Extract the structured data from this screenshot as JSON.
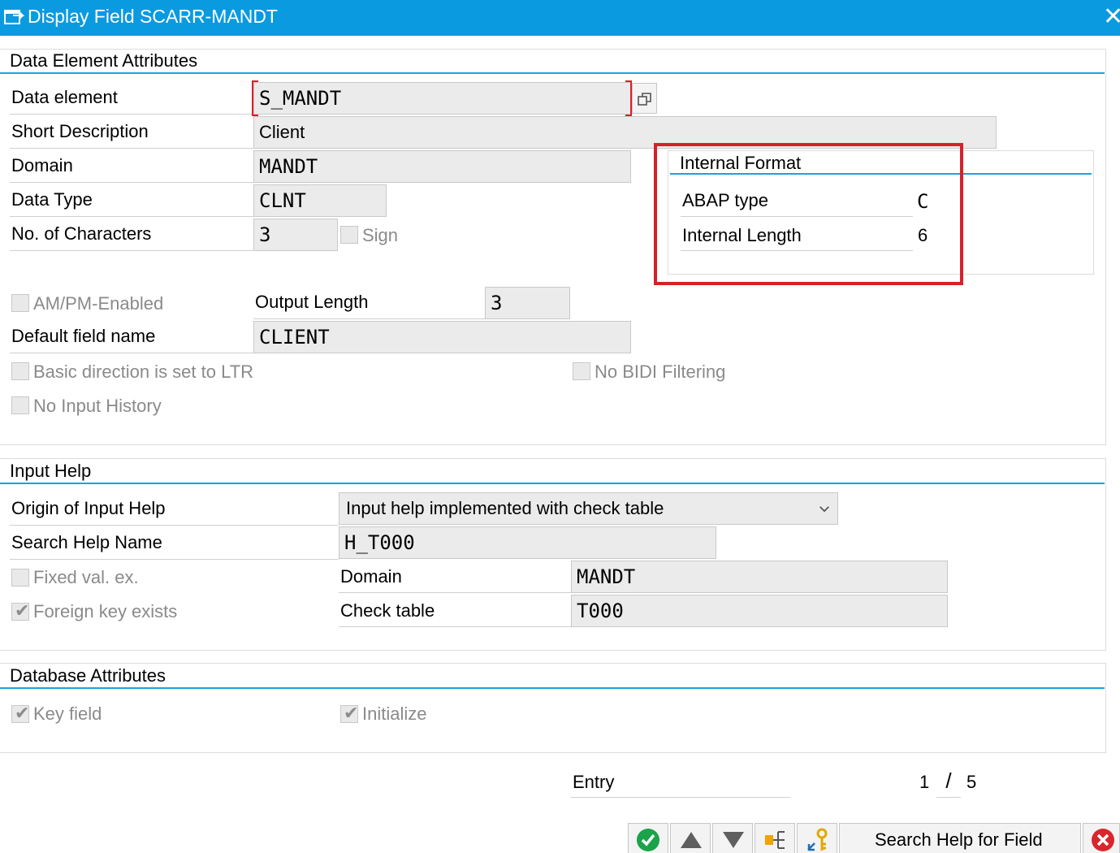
{
  "window": {
    "title": "Display Field SCARR-MANDT",
    "close_glyph": "✕"
  },
  "data_element_attributes": {
    "title": "Data Element Attributes",
    "data_element_label": "Data element",
    "data_element_value": "S_MANDT",
    "short_description_label": "Short Description",
    "short_description_value": "Client",
    "domain_label": "Domain",
    "domain_value": "MANDT",
    "data_type_label": "Data Type",
    "data_type_value": "CLNT",
    "no_of_characters_label": "No. of Characters",
    "no_of_characters_value": "3",
    "sign_label": "Sign",
    "am_pm_label": "AM/PM-Enabled",
    "output_length_label": "Output Length",
    "output_length_value": "3",
    "default_field_name_label": "Default field name",
    "default_field_name_value": "CLIENT",
    "basic_direction_label": "Basic direction is set to LTR",
    "no_bidi_label": "No BIDI Filtering",
    "no_input_history_label": "No Input History",
    "internal_format": {
      "title": "Internal Format",
      "abap_type_label": "ABAP type",
      "abap_type_value": "C",
      "internal_length_label": "Internal Length",
      "internal_length_value": "6"
    }
  },
  "input_help": {
    "title": "Input Help",
    "origin_label": "Origin of Input Help",
    "origin_value": "Input help implemented with check table",
    "search_help_name_label": "Search Help Name",
    "search_help_name_value": "H_T000",
    "fixed_val_label": "Fixed val. ex.",
    "domain_label": "Domain",
    "domain_value": "MANDT",
    "foreign_key_label": "Foreign key exists",
    "check_table_label": "Check table",
    "check_table_value": "T000"
  },
  "database_attributes": {
    "title": "Database Attributes",
    "key_field_label": "Key field",
    "initialize_label": "Initialize"
  },
  "entry": {
    "label": "Entry",
    "current": "1",
    "separator": "/",
    "total": "5"
  },
  "footer": {
    "search_help_button_label": "Search Help for Field"
  },
  "colors": {
    "title_bar": "#0a9ae0",
    "section_line": "#19a2e0",
    "highlight_box": "#d8202a",
    "confirm_green": "#1aa34a",
    "cancel_red": "#d9262c"
  }
}
